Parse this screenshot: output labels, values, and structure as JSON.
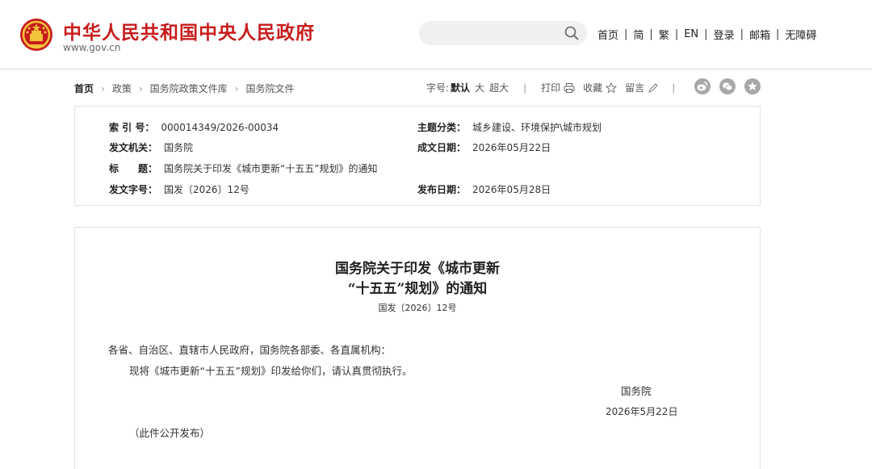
{
  "header": {
    "site_title": "中华人民共和国中央人民政府",
    "site_url": "www.gov.cn",
    "search_placeholder": "",
    "nav": [
      "首页",
      "简",
      "繁",
      "EN",
      "登录",
      "邮箱",
      "无障碍"
    ],
    "nav_separator": "|",
    "colors": {
      "brand_red": "#c81c1c"
    }
  },
  "breadcrumb": {
    "items": [
      "首页",
      "政策",
      "国务院政策文件库",
      "国务院文件"
    ],
    "separator": "›"
  },
  "tools": {
    "font_size_label": "字号:",
    "font_default": "默认",
    "font_large": "大",
    "font_xlarge": "超大",
    "divider": "|",
    "print_label": "打印",
    "favorite_label": "收藏",
    "comment_label": "留言",
    "icons": [
      "printer-icon",
      "star-icon",
      "pencil-icon"
    ],
    "share_icons": [
      "weibo-icon",
      "wechat-icon",
      "favorite-circle-icon"
    ]
  },
  "meta": {
    "index_key": "索 引 号：",
    "index_value": "000014349/2026-00034",
    "topic_key": "主题分类：",
    "topic_value": "城乡建设、环境保护\\城市规划",
    "issuer_key": "发文机关：",
    "issuer_value": "国务院",
    "written_key": "成文日期：",
    "written_value": "2026年05月22日",
    "title_key": "标　　题：",
    "title_value": "国务院关于印发《城市更新“十五五”规划》的通知",
    "docno_key": "发文字号：",
    "docno_value": "国发〔2026〕12号",
    "publish_key": "发布日期：",
    "publish_value": "2026年05月28日"
  },
  "article": {
    "title_line1": "国务院关于印发《城市更新",
    "title_line2": "“十五五”规划》的通知",
    "doc_number": "国发〔2026〕12号",
    "salutation": "各省、自治区、直辖市人民政府，国务院各部委、各直属机构：",
    "body": "现将《城市更新“十五五”规划》印发给你们，请认真贯彻执行。",
    "signature": "国务院",
    "date": "2026年5月22日",
    "note": "（此件公开发布）"
  }
}
